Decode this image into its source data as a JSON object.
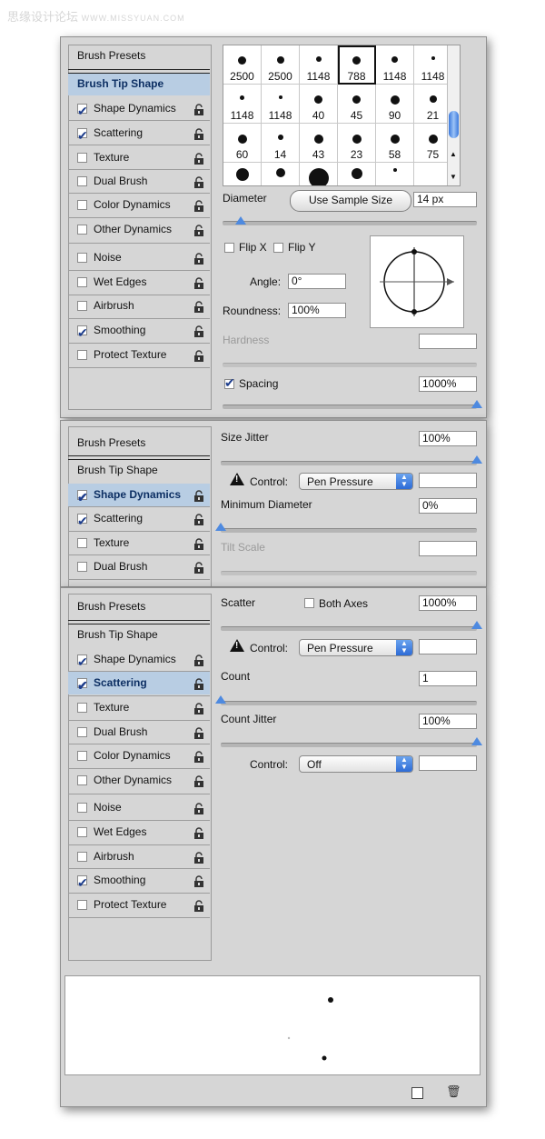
{
  "watermark": {
    "cn": "思缘设计论坛",
    "url": "WWW.MISSYUAN.COM"
  },
  "panel1": {
    "sections": [
      {
        "label": "Brush Presets"
      },
      {
        "label": "Brush Tip Shape"
      },
      {
        "label": "Shape Dynamics",
        "checked": true
      },
      {
        "label": "Scattering",
        "checked": true
      },
      {
        "label": "Texture",
        "checked": false
      },
      {
        "label": "Dual Brush",
        "checked": false
      },
      {
        "label": "Color Dynamics",
        "checked": false
      },
      {
        "label": "Other Dynamics",
        "checked": false
      },
      {
        "label": "Noise",
        "checked": false
      },
      {
        "label": "Wet Edges",
        "checked": false
      },
      {
        "label": "Airbrush",
        "checked": false
      },
      {
        "label": "Smoothing",
        "checked": true
      },
      {
        "label": "Protect Texture",
        "checked": false
      }
    ],
    "presets": [
      "2500",
      "2500",
      "1148",
      "788",
      "1148",
      "1148",
      "1148",
      "1148",
      "40",
      "45",
      "90",
      "21",
      "60",
      "14",
      "43",
      "23",
      "58",
      "75"
    ],
    "diameter_label": "Diameter",
    "use_sample_size": "Use Sample Size",
    "diameter_value": "14 px",
    "diameter_slider": 0.07,
    "flip_x": "Flip X",
    "flip_y": "Flip Y",
    "angle_label": "Angle:",
    "angle_value": "0°",
    "roundness_label": "Roundness:",
    "roundness_value": "100%",
    "hardness_label": "Hardness",
    "spacing_label": "Spacing",
    "spacing_value": "1000%",
    "spacing_slider": 1.0
  },
  "panel2": {
    "sections": [
      {
        "label": "Brush Presets"
      },
      {
        "label": "Brush Tip Shape"
      },
      {
        "label": "Shape Dynamics",
        "checked": true
      },
      {
        "label": "Scattering",
        "checked": true
      },
      {
        "label": "Texture",
        "checked": false
      },
      {
        "label": "Dual Brush",
        "checked": false
      }
    ],
    "size_jitter_label": "Size Jitter",
    "size_jitter_value": "100%",
    "size_jitter_slider": 1.0,
    "control_label": "Control:",
    "control_value": "Pen Pressure",
    "min_diameter_label": "Minimum Diameter",
    "min_diameter_value": "0%",
    "min_diameter_slider": 0.0,
    "tilt_scale_label": "Tilt Scale"
  },
  "panel3": {
    "sections": [
      {
        "label": "Brush Presets"
      },
      {
        "label": "Brush Tip Shape"
      },
      {
        "label": "Shape Dynamics",
        "checked": true
      },
      {
        "label": "Scattering",
        "checked": true
      },
      {
        "label": "Texture",
        "checked": false
      },
      {
        "label": "Dual Brush",
        "checked": false
      },
      {
        "label": "Color Dynamics",
        "checked": false
      },
      {
        "label": "Other Dynamics",
        "checked": false
      },
      {
        "label": "Noise",
        "checked": false
      },
      {
        "label": "Wet Edges",
        "checked": false
      },
      {
        "label": "Airbrush",
        "checked": false
      },
      {
        "label": "Smoothing",
        "checked": true
      },
      {
        "label": "Protect Texture",
        "checked": false
      }
    ],
    "scatter_label": "Scatter",
    "both_axes_label": "Both Axes",
    "scatter_value": "1000%",
    "scatter_slider": 1.0,
    "control_label": "Control:",
    "control_value": "Pen Pressure",
    "count_label": "Count",
    "count_value": "1",
    "count_slider": 0.0,
    "count_jitter_label": "Count Jitter",
    "count_jitter_value": "100%",
    "count_jitter_slider": 1.0,
    "control2_label": "Control:",
    "control2_value": "Off"
  }
}
